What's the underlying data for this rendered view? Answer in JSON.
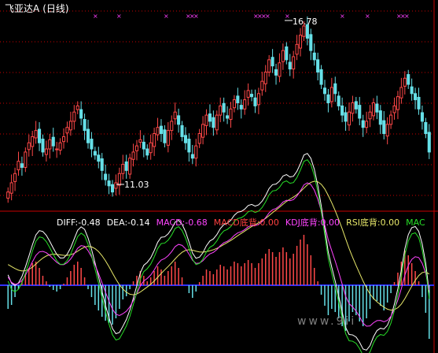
{
  "title": {
    "stock": "飞亚达A",
    "period": "(日线)"
  },
  "price_labels": {
    "high": "16.78",
    "low": "11.03"
  },
  "indicator_legend": [
    {
      "key": "diff",
      "text": "DIFF:-0.48",
      "color": "#ffffff"
    },
    {
      "key": "dea",
      "text": "DEA:-0.14",
      "color": "#ffffff"
    },
    {
      "key": "macd",
      "text": "MACD:-0.68",
      "color": "#ff44ff"
    },
    {
      "key": "macd_div",
      "text": "MACD底背:0.00",
      "color": "#ff4040"
    },
    {
      "key": "kdj_div",
      "text": "KDJ底背:0.00",
      "color": "#ff44ff"
    },
    {
      "key": "rsi_div",
      "text": "RSI底背:0.00",
      "color": "#e8e86a"
    },
    {
      "key": "mac",
      "text": "MAC",
      "color": "#28e028"
    }
  ],
  "watermark": "www.9ii",
  "colors": {
    "background": "#000000",
    "up_candle": "#ff4848",
    "down_candle": "#66e0e8",
    "grid": "#c80000",
    "marker": "#ff40ff",
    "axis_blue": "#3030ff"
  },
  "chart_data": {
    "type": "candlestick",
    "price_high": 16.78,
    "price_low": 11.03,
    "closes": [
      11.3,
      11.6,
      11.9,
      12.3,
      12.1,
      12.6,
      12.9,
      13.1,
      13.3,
      12.9,
      12.6,
      12.7,
      13.0,
      12.8,
      12.7,
      12.9,
      13.1,
      13.4,
      13.6,
      13.9,
      14.1,
      13.7,
      13.3,
      12.9,
      12.7,
      12.5,
      12.3,
      12.0,
      11.7,
      11.5,
      11.3,
      11.6,
      11.9,
      12.2,
      12.0,
      12.4,
      12.6,
      12.8,
      13.0,
      12.7,
      12.5,
      12.9,
      13.2,
      13.4,
      13.2,
      12.9,
      13.3,
      13.6,
      13.9,
      13.5,
      13.1,
      12.9,
      12.6,
      12.4,
      12.8,
      13.2,
      13.5,
      13.8,
      13.6,
      13.4,
      13.8,
      14.1,
      13.9,
      13.7,
      14.0,
      14.3,
      14.2,
      14.0,
      14.3,
      14.6,
      14.4,
      14.1,
      14.5,
      14.9,
      15.2,
      15.6,
      15.4,
      15.1,
      15.5,
      15.9,
      15.6,
      15.3,
      15.7,
      16.1,
      16.4,
      16.7,
      16.3,
      15.9,
      15.6,
      15.2,
      14.8,
      14.5,
      14.2,
      14.7,
      14.5,
      14.1,
      13.8,
      13.6,
      13.9,
      14.2,
      14.0,
      13.7,
      13.4,
      13.6,
      13.9,
      14.2,
      13.9,
      13.5,
      13.2,
      13.5,
      13.8,
      14.1,
      14.4,
      14.7,
      15.0,
      14.8,
      14.5,
      14.3,
      14.0,
      13.6,
      13.2,
      12.6
    ],
    "macd_hist": [
      -0.3,
      -0.25,
      -0.15,
      -0.05,
      0.05,
      0.15,
      0.22,
      0.28,
      0.3,
      0.22,
      0.12,
      0.05,
      -0.02,
      -0.06,
      -0.08,
      -0.05,
      0.02,
      0.1,
      0.18,
      0.26,
      0.3,
      0.22,
      0.1,
      -0.05,
      -0.15,
      -0.25,
      -0.32,
      -0.4,
      -0.45,
      -0.48,
      -0.5,
      -0.42,
      -0.3,
      -0.18,
      -0.14,
      -0.05,
      0.05,
      0.12,
      0.18,
      0.12,
      0.05,
      0.1,
      0.18,
      0.24,
      0.2,
      0.12,
      0.18,
      0.24,
      0.3,
      0.22,
      0.1,
      0.0,
      -0.1,
      -0.16,
      -0.08,
      0.04,
      0.12,
      0.2,
      0.18,
      0.14,
      0.2,
      0.26,
      0.24,
      0.2,
      0.24,
      0.3,
      0.28,
      0.24,
      0.28,
      0.32,
      0.28,
      0.22,
      0.28,
      0.34,
      0.4,
      0.46,
      0.42,
      0.36,
      0.42,
      0.48,
      0.42,
      0.34,
      0.4,
      0.5,
      0.58,
      0.64,
      0.52,
      0.38,
      0.22,
      0.05,
      -0.12,
      -0.26,
      -0.38,
      -0.3,
      -0.34,
      -0.42,
      -0.52,
      -0.58,
      -0.46,
      -0.34,
      -0.38,
      -0.46,
      -0.52,
      -0.42,
      -0.3,
      -0.18,
      -0.2,
      -0.26,
      -0.32,
      -0.22,
      -0.1,
      0.04,
      0.16,
      0.3,
      0.44,
      0.38,
      0.28,
      0.18,
      0.05,
      -0.15,
      -0.35,
      -0.68
    ]
  }
}
